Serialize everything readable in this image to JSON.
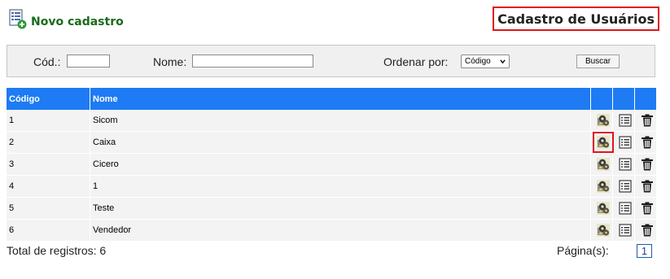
{
  "header": {
    "new_label": "Novo cadastro",
    "title": "Cadastro de Usuários"
  },
  "filters": {
    "code_label": "Cód.:",
    "code_value": "",
    "name_label": "Nome:",
    "name_value": "",
    "order_label": "Ordenar por:",
    "order_selected": "Código",
    "search_button": "Buscar"
  },
  "table": {
    "columns": [
      "Código",
      "Nome",
      "",
      "",
      ""
    ],
    "rows": [
      {
        "code": "1",
        "name": "Sicom"
      },
      {
        "code": "2",
        "name": "Caixa"
      },
      {
        "code": "3",
        "name": "Cicero"
      },
      {
        "code": "4",
        "name": "1"
      },
      {
        "code": "5",
        "name": "Teste"
      },
      {
        "code": "6",
        "name": "Vendedor"
      }
    ],
    "row_actions": [
      "permissions-icon",
      "details-icon",
      "trash-icon"
    ]
  },
  "footer": {
    "total_label": "Total de registros: 6",
    "pages_label": "Página(s):",
    "current_page": "1"
  },
  "colors": {
    "header_bg": "#1e7bf4",
    "highlight_border": "#e0141a",
    "new_link": "#1a6b1a"
  }
}
